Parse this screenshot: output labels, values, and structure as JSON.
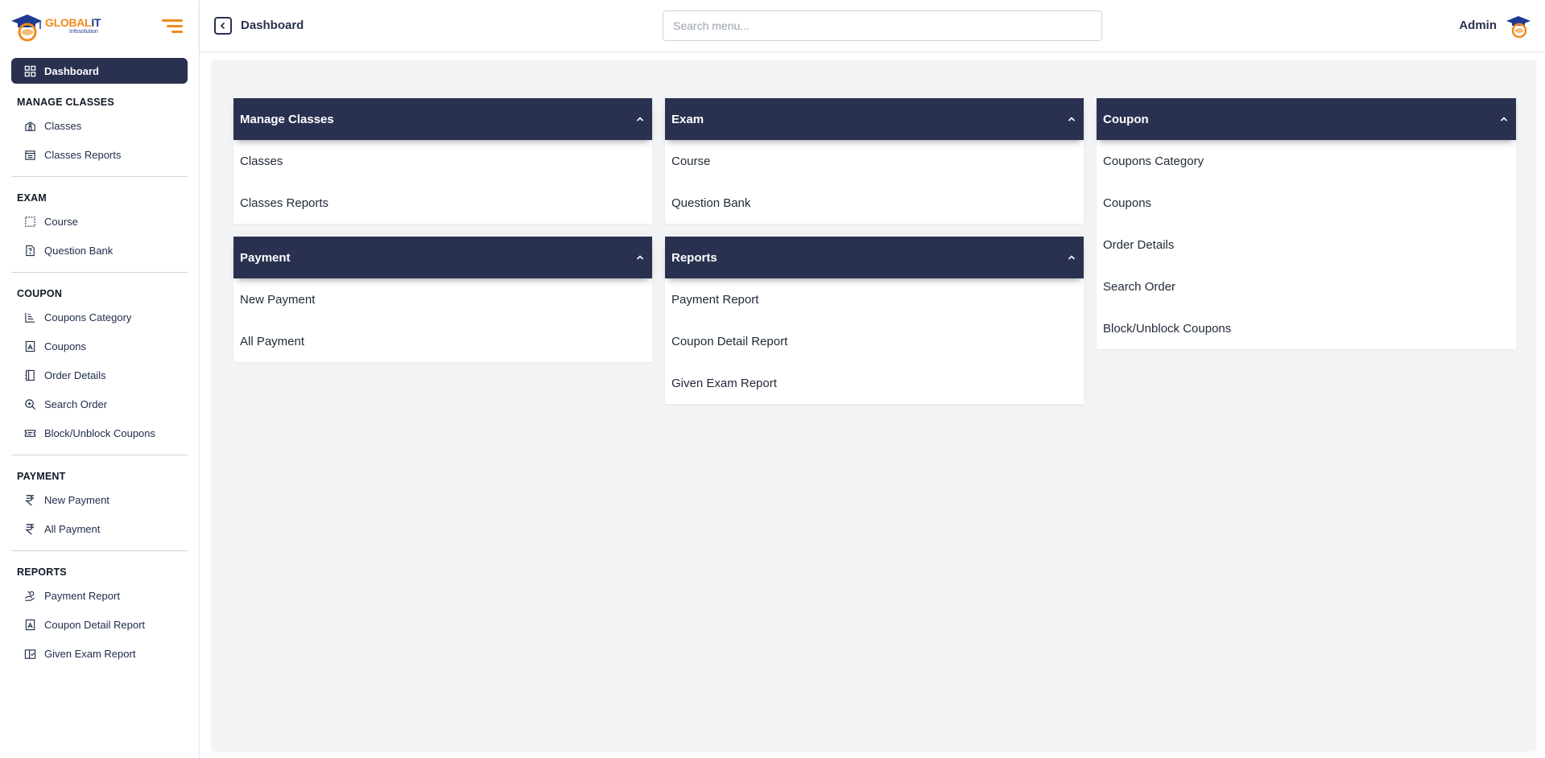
{
  "brand": {
    "name_part1": "GLOBAL",
    "name_part2": "IT",
    "tagline": "Infosolution",
    "accent": "#f08a1c",
    "dark": "#2a3150"
  },
  "sidebar": {
    "active": {
      "label": "Dashboard",
      "icon": "dashboard-icon"
    },
    "sections": [
      {
        "title": "MANAGE CLASSES",
        "items": [
          {
            "label": "Classes",
            "icon": "school-icon"
          },
          {
            "label": "Classes Reports",
            "icon": "building-report-icon"
          }
        ]
      },
      {
        "title": "EXAM",
        "items": [
          {
            "label": "Course",
            "icon": "dashed-square-icon"
          },
          {
            "label": "Question Bank",
            "icon": "question-file-icon"
          }
        ]
      },
      {
        "title": "COUPON",
        "items": [
          {
            "label": "Coupons Category",
            "icon": "chart-icon"
          },
          {
            "label": "Coupons",
            "icon": "coupon-icon"
          },
          {
            "label": "Order Details",
            "icon": "notebook-icon"
          },
          {
            "label": "Search Order",
            "icon": "search-icon"
          },
          {
            "label": "Block/Unblock Coupons",
            "icon": "ticket-icon"
          }
        ]
      },
      {
        "title": "PAYMENT",
        "items": [
          {
            "label": "New Payment",
            "icon": "rupee-icon"
          },
          {
            "label": "All Payment",
            "icon": "rupee-icon"
          }
        ]
      },
      {
        "title": "REPORTS",
        "items": [
          {
            "label": "Payment Report",
            "icon": "hand-coins-icon"
          },
          {
            "label": "Coupon Detail Report",
            "icon": "coupon-icon"
          },
          {
            "label": "Given Exam Report",
            "icon": "book-check-icon"
          }
        ]
      }
    ]
  },
  "header": {
    "title": "Dashboard",
    "search_placeholder": "Search menu...",
    "user": "Admin"
  },
  "cards": [
    {
      "title": "Manage Classes",
      "links": [
        "Classes",
        "Classes Reports"
      ]
    },
    {
      "title": "Exam",
      "links": [
        "Course",
        "Question Bank"
      ]
    },
    {
      "title": "Coupon",
      "links": [
        "Coupons Category",
        "Coupons",
        "Order Details",
        "Search Order",
        "Block/Unblock Coupons"
      ]
    },
    {
      "title": "Payment",
      "links": [
        "New Payment",
        "All Payment"
      ]
    },
    {
      "title": "Reports",
      "links": [
        "Payment Report",
        "Coupon Detail Report",
        "Given Exam Report"
      ]
    }
  ]
}
